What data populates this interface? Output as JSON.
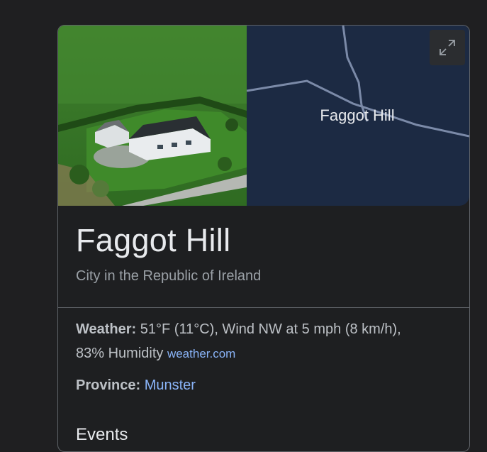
{
  "place": {
    "name": "Faggot Hill",
    "description": "City in the Republic of Ireland"
  },
  "map": {
    "label": "Faggot Hill",
    "expand_icon": "expand-icon"
  },
  "weather": {
    "label": "Weather:",
    "text_line1": "51°F (11°C), Wind NW at 5 mph (8 km/h),",
    "text_line2": "83% Humidity",
    "source_link": "weather.com"
  },
  "province": {
    "label": "Province:",
    "value": "Munster"
  },
  "events": {
    "title": "Events"
  },
  "colors": {
    "background": "#1f1f21",
    "card_border": "#5f6368",
    "map_background": "#1c2a43",
    "map_road": "#7b8aa8",
    "link": "#8ab4f8",
    "title_text": "#e8eaed",
    "secondary_text": "#9aa0a6"
  }
}
